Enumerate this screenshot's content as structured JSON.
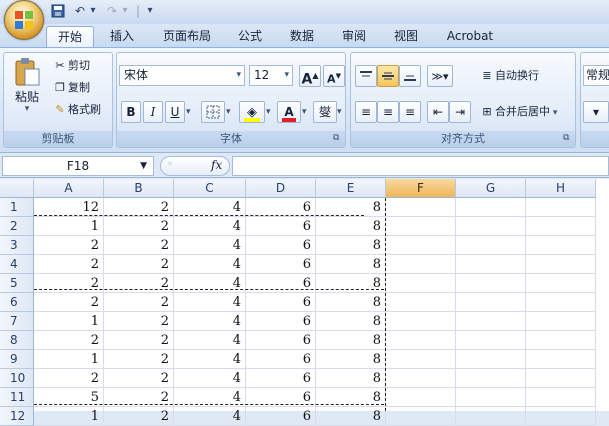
{
  "quick_access": {
    "undo_arrow": "↶",
    "redo_arrow": "↷",
    "dropdown_arrow": "▾",
    "separator": "|"
  },
  "tabs": [
    {
      "label": "开始",
      "active": true
    },
    {
      "label": "插入"
    },
    {
      "label": "页面布局"
    },
    {
      "label": "公式"
    },
    {
      "label": "数据"
    },
    {
      "label": "审阅"
    },
    {
      "label": "视图"
    },
    {
      "label": "Acrobat"
    }
  ],
  "clipboard": {
    "paste_label": "粘贴",
    "cut_label": "剪切",
    "copy_label": "复制",
    "format_painter_label": "格式刷",
    "group_label": "剪贴板"
  },
  "font": {
    "font_name": "宋体",
    "font_size": "12",
    "grow_label": "A",
    "shrink_label": "A",
    "bold": "B",
    "italic": "I",
    "underline": "U",
    "font_color_letter": "A",
    "phonetic_label": "燮",
    "group_label": "字体"
  },
  "alignment": {
    "wrap_text_label": "自动换行",
    "merge_center_label": "合并后居中",
    "group_label": "对齐方式"
  },
  "number": {
    "format_value": "常规"
  },
  "formula_bar": {
    "name_box": "F18",
    "fx_label": "fx",
    "formula_value": ""
  },
  "grid": {
    "columns": [
      "A",
      "B",
      "C",
      "D",
      "E",
      "F",
      "G",
      "H"
    ],
    "selected_column": "F",
    "rows": [
      {
        "n": "1",
        "cells": [
          "12",
          "2",
          "4",
          "6",
          "8"
        ]
      },
      {
        "n": "2",
        "cells": [
          "1",
          "2",
          "4",
          "6",
          "8"
        ]
      },
      {
        "n": "3",
        "cells": [
          "2",
          "2",
          "4",
          "6",
          "8"
        ]
      },
      {
        "n": "4",
        "cells": [
          "2",
          "2",
          "4",
          "6",
          "8"
        ]
      },
      {
        "n": "5",
        "cells": [
          "2",
          "2",
          "4",
          "6",
          "8"
        ]
      },
      {
        "n": "6",
        "cells": [
          "2",
          "2",
          "4",
          "6",
          "8"
        ]
      },
      {
        "n": "7",
        "cells": [
          "1",
          "2",
          "4",
          "6",
          "8"
        ]
      },
      {
        "n": "8",
        "cells": [
          "2",
          "2",
          "4",
          "6",
          "8"
        ]
      },
      {
        "n": "9",
        "cells": [
          "1",
          "2",
          "4",
          "6",
          "8"
        ]
      },
      {
        "n": "10",
        "cells": [
          "2",
          "2",
          "4",
          "6",
          "8"
        ]
      },
      {
        "n": "11",
        "cells": [
          "5",
          "2",
          "4",
          "6",
          "8"
        ]
      },
      {
        "n": "12",
        "cells": [
          "1",
          "2",
          "4",
          "6",
          "8"
        ]
      }
    ]
  },
  "colors": {
    "accent": "#f0b558",
    "ribbon_border": "#8db2e3"
  }
}
